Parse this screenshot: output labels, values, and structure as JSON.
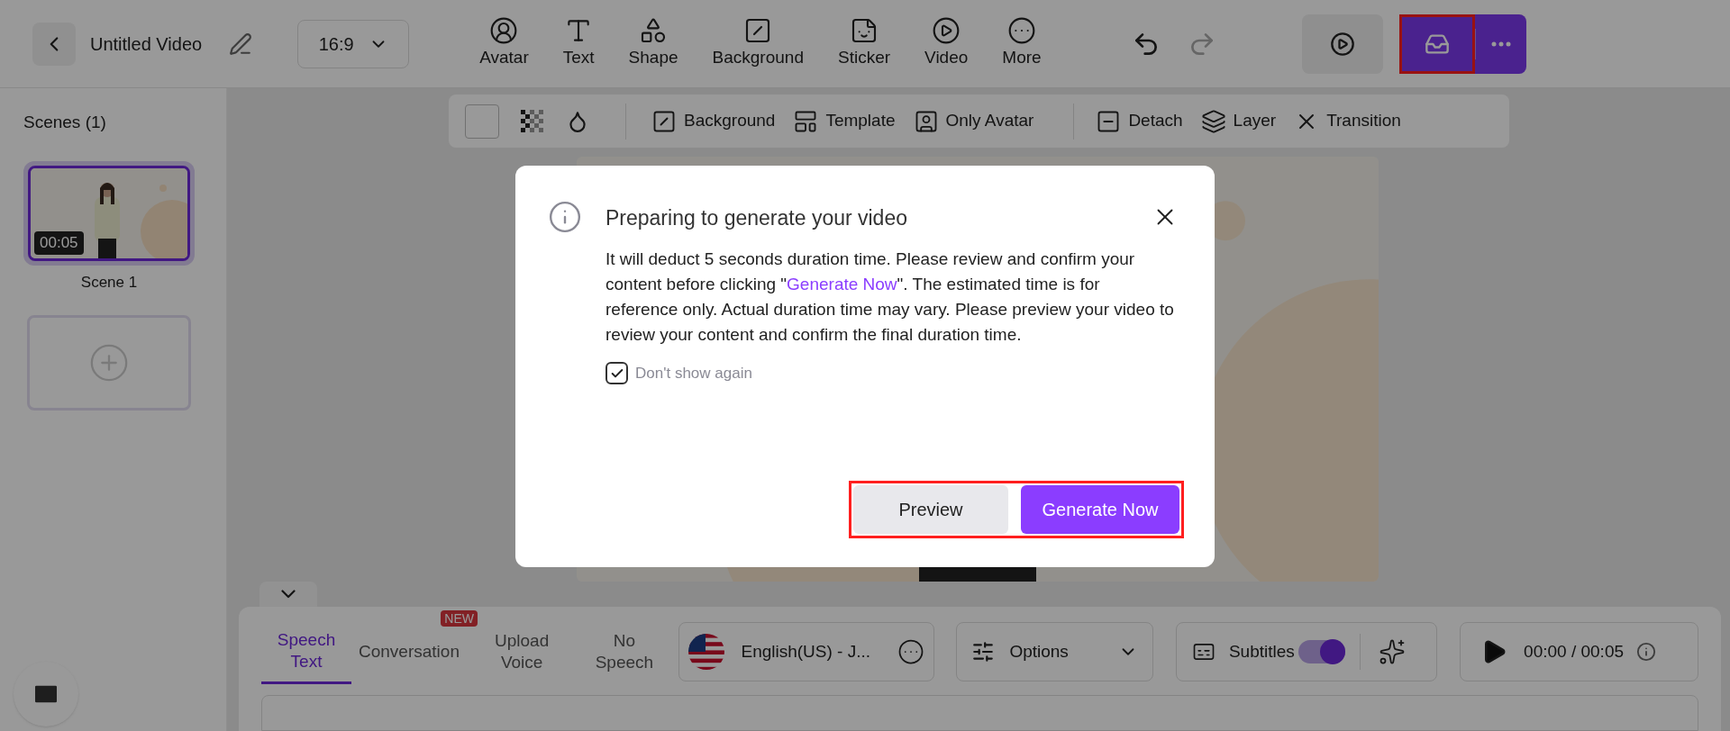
{
  "top_bar": {
    "title": "Untitled Video",
    "aspect": "16:9",
    "tools": [
      {
        "label": "Avatar",
        "kind": "avatar"
      },
      {
        "label": "Text",
        "kind": "text"
      },
      {
        "label": "Shape",
        "kind": "shape"
      },
      {
        "label": "Background",
        "kind": "background"
      },
      {
        "label": "Sticker",
        "kind": "sticker"
      },
      {
        "label": "Video",
        "kind": "video"
      },
      {
        "label": "More",
        "kind": "more"
      }
    ]
  },
  "canvas_toolbar": {
    "items": [
      {
        "label": "Background",
        "kind": "background"
      },
      {
        "label": "Template",
        "kind": "template"
      },
      {
        "label": "Only Avatar",
        "kind": "avatar"
      },
      {
        "label": "Detach",
        "kind": "detach"
      },
      {
        "label": "Layer",
        "kind": "layer"
      },
      {
        "label": "Transition",
        "kind": "transition"
      }
    ]
  },
  "scenes": {
    "title": "Scenes (1)",
    "items": [
      {
        "label": "Scene 1",
        "duration": "00:05",
        "selected": true
      }
    ]
  },
  "bottom_panel": {
    "tabs": [
      {
        "label": "Speech Text",
        "selected": true
      },
      {
        "label": "Conversation",
        "selected": false,
        "badge": "NEW"
      },
      {
        "label": "Upload Voice",
        "selected": false
      },
      {
        "label": "No Speech",
        "selected": false
      }
    ],
    "voice": "English(US) - J...",
    "options": "Options",
    "subtitles": {
      "label": "Subtitles",
      "on": true
    },
    "time": "00:00 / 00:05"
  },
  "dialog": {
    "title": "Preparing to generate your video",
    "body_before": "It will deduct 5 seconds duration time. Please review and confirm your content before clicking \"",
    "body_link": "Generate Now",
    "body_after": "\". The estimated time is for reference only. Actual duration time may vary. Please preview your video to review your content and confirm the final duration time.",
    "checkbox": {
      "label": "Don't show again",
      "checked": true
    },
    "buttons": [
      {
        "label": "Preview",
        "kind": "secondary"
      },
      {
        "label": "Generate Now",
        "kind": "primary"
      }
    ]
  }
}
